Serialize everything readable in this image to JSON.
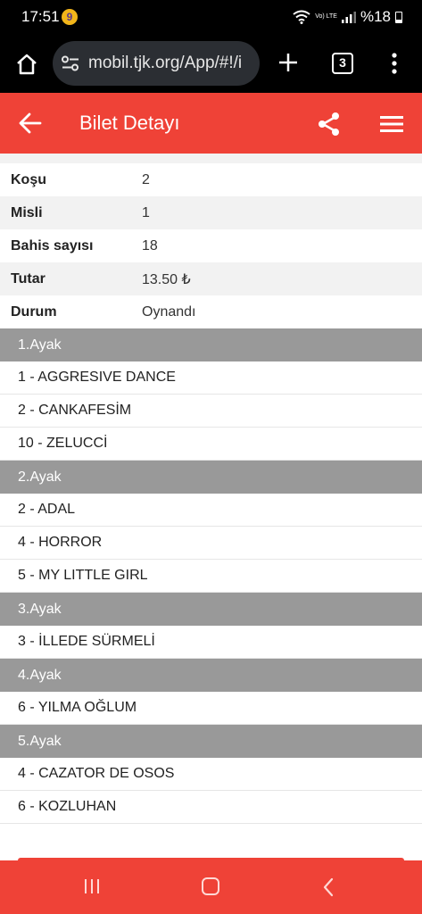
{
  "status_bar": {
    "time": "17:51",
    "app_icon_glyph": "9",
    "lte": "Vo) LTE",
    "battery": "%18"
  },
  "browser": {
    "url": "mobil.tjk.org/App/#!/i",
    "tab_count": "3"
  },
  "header": {
    "title": "Bilet Detayı"
  },
  "details": [
    {
      "label": "Koşu",
      "value": "2"
    },
    {
      "label": "Misli",
      "value": "1"
    },
    {
      "label": "Bahis sayısı",
      "value": "18"
    },
    {
      "label": "Tutar",
      "value": "13.50 ₺"
    },
    {
      "label": "Durum",
      "value": "Oynandı"
    }
  ],
  "legs": [
    {
      "title": "1.Ayak",
      "horses": [
        "1 - AGGRESIVE DANCE",
        "2 - CANKAFESİM",
        "10 - ZELUCCİ"
      ]
    },
    {
      "title": "2.Ayak",
      "horses": [
        "2 - ADAL",
        "4 - HORROR",
        "5 - MY LITTLE GIRL"
      ]
    },
    {
      "title": "3.Ayak",
      "horses": [
        "3 - İLLEDE SÜRMELİ"
      ]
    },
    {
      "title": "4.Ayak",
      "horses": [
        "6 - YILMA OĞLUM"
      ]
    },
    {
      "title": "5.Ayak",
      "horses": [
        "4 - CAZATOR DE OSOS",
        "6 - KOZLUHAN"
      ]
    }
  ],
  "colors": {
    "accent": "#ef4237",
    "leg_header": "#999999",
    "row_shade": "#f2f2f2"
  },
  "icons": [
    "home-icon",
    "tune-icon",
    "plus-icon",
    "tabs-icon",
    "more-vert-icon",
    "arrow-back-icon",
    "share-icon",
    "menu-icon",
    "recents-icon",
    "home-nav-icon",
    "back-nav-icon"
  ]
}
